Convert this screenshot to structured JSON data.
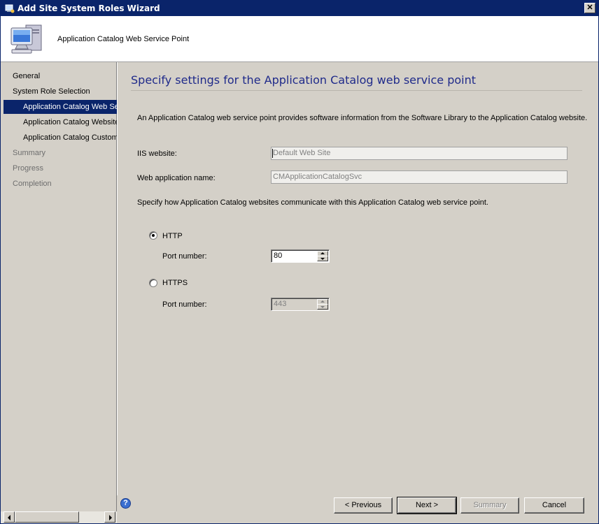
{
  "window": {
    "title": "Add Site System Roles Wizard"
  },
  "header": {
    "title": "Application Catalog Web Service Point"
  },
  "nav": {
    "items": [
      {
        "label": "General"
      },
      {
        "label": "System Role Selection"
      },
      {
        "label": "Application Catalog Web Service Point"
      },
      {
        "label": "Application Catalog Website"
      },
      {
        "label": "Application Catalog Customizations"
      },
      {
        "label": "Summary"
      },
      {
        "label": "Progress"
      },
      {
        "label": "Completion"
      }
    ]
  },
  "page": {
    "title": "Specify settings for the Application Catalog web service point",
    "description": "An Application Catalog web service point provides software information from the Software Library to the Application Catalog website.",
    "iis_label": "IIS website:",
    "iis_value": "Default Web Site",
    "webapp_label": "Web application name:",
    "webapp_value": "CMApplicationCatalogSvc",
    "instruction": "Specify how Application Catalog websites communicate with this Application Catalog web service point.",
    "http_label": "HTTP",
    "http_port_label": "Port number:",
    "http_port": "80",
    "https_label": "HTTPS",
    "https_port_label": "Port number:",
    "https_port": "443",
    "selected_protocol": "HTTP"
  },
  "footer": {
    "previous": "< Previous",
    "next": "Next >",
    "summary": "Summary",
    "cancel": "Cancel"
  },
  "colors": {
    "accent": "#0a246a",
    "title_text": "#1f2a8a",
    "panel": "#d4d0c8"
  }
}
